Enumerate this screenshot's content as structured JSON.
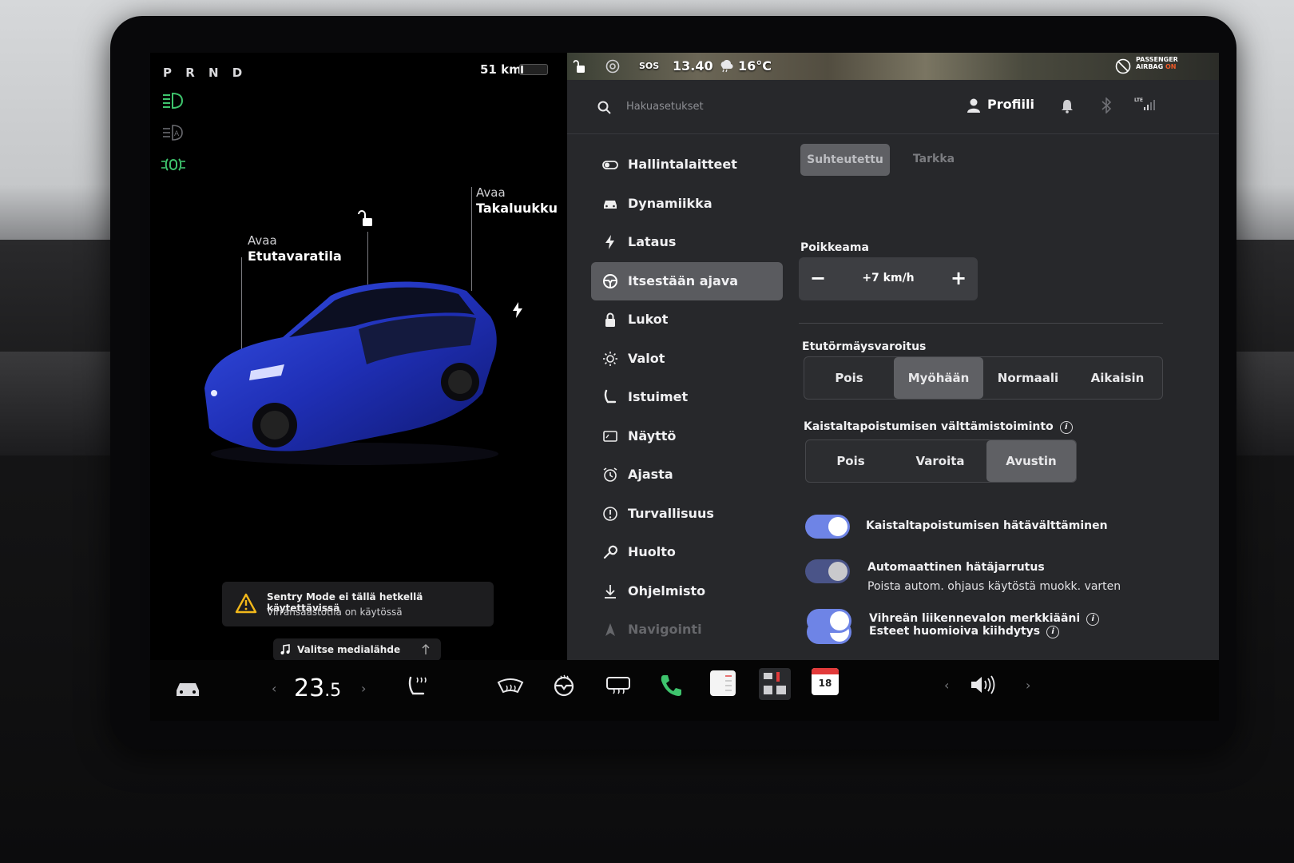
{
  "status": {
    "gear": "P R N D",
    "range": "51 km",
    "battery_level": 0.1,
    "time": "13.40",
    "temperature": "16°C",
    "sos": "SOS",
    "airbag_line1": "PASSENGER",
    "airbag_line2": "AIRBAG",
    "airbag_state": "ON"
  },
  "car_view": {
    "frunk_open": "Avaa",
    "frunk_label": "Etutavaratila",
    "trunk_open": "Avaa",
    "trunk_label": "Takaluukku",
    "body_color": "#2437c8"
  },
  "alert": {
    "title": "Sentry Mode ei tällä hetkellä käytettävissä",
    "subtitle": "Virransäästötila on käytössä"
  },
  "media": {
    "label": "Valitse medialähde"
  },
  "search": {
    "placeholder": "Hakuasetukset"
  },
  "profile": {
    "label": "Profiili"
  },
  "nav": [
    {
      "label": "Hallintalaitteet",
      "icon": "toggle-icon"
    },
    {
      "label": "Dynamiikka",
      "icon": "car-icon"
    },
    {
      "label": "Lataus",
      "icon": "bolt-icon"
    },
    {
      "label": "Itsestään ajava",
      "icon": "steering-wheel-icon",
      "active": true
    },
    {
      "label": "Lukot",
      "icon": "lock-icon"
    },
    {
      "label": "Valot",
      "icon": "sun-icon"
    },
    {
      "label": "Istuimet",
      "icon": "seat-icon"
    },
    {
      "label": "Näyttö",
      "icon": "display-icon"
    },
    {
      "label": "Ajasta",
      "icon": "alarm-clock-icon"
    },
    {
      "label": "Turvallisuus",
      "icon": "alert-circle-icon"
    },
    {
      "label": "Huolto",
      "icon": "wrench-icon"
    },
    {
      "label": "Ohjelmisto",
      "icon": "download-icon"
    },
    {
      "label": "Navigointi",
      "icon": "navigation-icon"
    }
  ],
  "autopilot": {
    "speed_mode": {
      "options": [
        "Suhteutettu",
        "Tarkka"
      ],
      "selected": "Suhteutettu"
    },
    "offset": {
      "label": "Poikkeama",
      "value": "+7 km/h",
      "minus": "−",
      "plus": "+"
    },
    "fcw": {
      "label": "Etutörmäysvaroitus",
      "options": [
        "Pois",
        "Myöhään",
        "Normaali",
        "Aikaisin"
      ],
      "selected": "Myöhään"
    },
    "lda": {
      "label": "Kaistaltapoistumisen välttämistoiminto",
      "options": [
        "Pois",
        "Varoita",
        "Avustin"
      ],
      "selected": "Avustin"
    },
    "toggles": [
      {
        "label": "Kaistaltapoistumisen hätävälttäminen",
        "on": true
      },
      {
        "label": "Automaattinen hätäjarrutus",
        "sub": "Poista autom. ohjaus käytöstä muokk. varten",
        "on": true,
        "disabled": true
      },
      {
        "label": "Esteet huomioiva kiihdytys",
        "on": true,
        "info": true
      },
      {
        "label": "Vihreän liikennevalon merkkiääni",
        "on": true,
        "info": true
      }
    ]
  },
  "dock": {
    "temp_whole": "23",
    "temp_decimal": ".5",
    "calendar_day": "18",
    "accent_green": "#3ec46d"
  }
}
